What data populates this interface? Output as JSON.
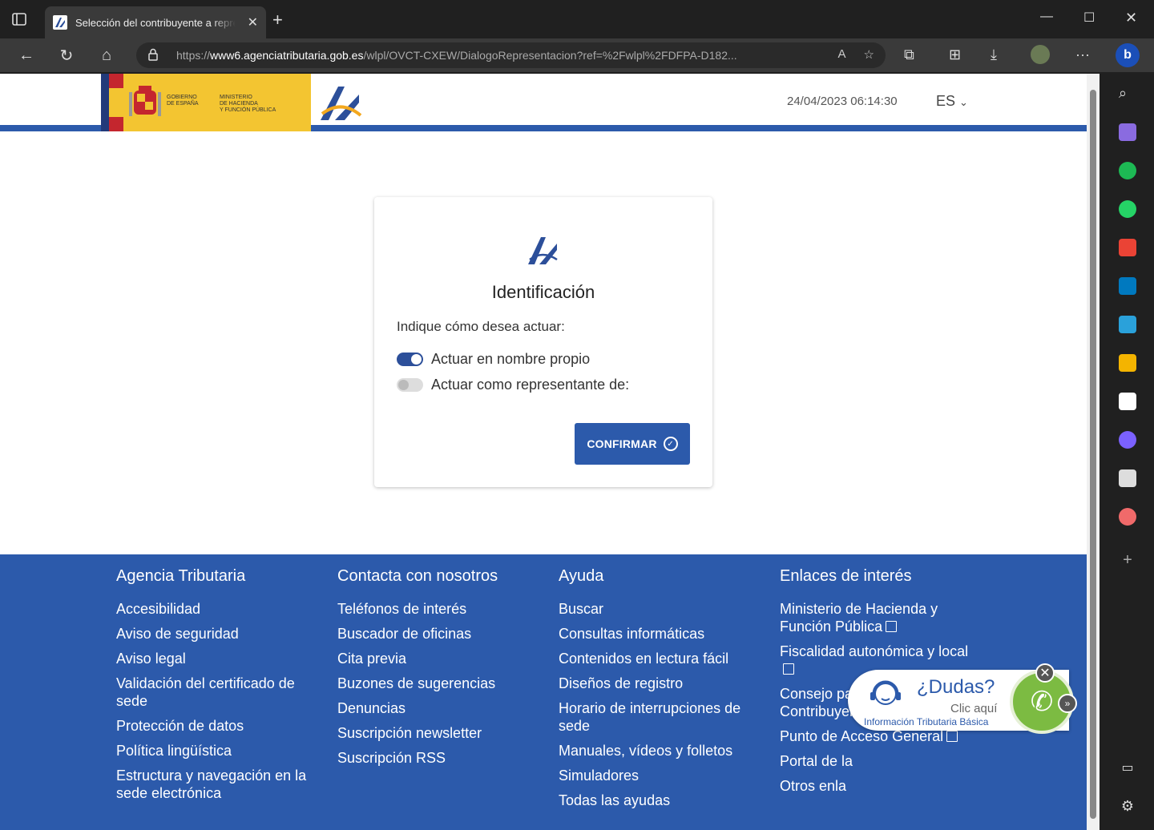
{
  "browser": {
    "tab_title": "Selección del contribuyente a representar",
    "url_prefix": "https://",
    "url_host": "www6.agenciatributaria.gob.es",
    "url_path": "/wlpl/OVCT-CXEW/DialogoRepresentacion?ref=%2Fwlpl%2FDFPA-D182..."
  },
  "header": {
    "gov_line1": "GOBIERNO",
    "gov_line2": "DE ESPAÑA",
    "min_line1": "MINISTERIO",
    "min_line2": "DE HACIENDA",
    "min_line3": "Y FUNCIÓN PÚBLICA",
    "datetime": "24/04/2023 06:14:30",
    "language": "ES"
  },
  "dialog": {
    "title": "Identificación",
    "prompt": "Indique cómo desea actuar:",
    "option_own": "Actuar en nombre propio",
    "option_own_checked": true,
    "option_rep": "Actuar como representante de:",
    "option_rep_checked": false,
    "confirm_label": "CONFIRMAR"
  },
  "footer": {
    "col1": {
      "title": "Agencia Tributaria",
      "links": [
        "Accesibilidad",
        "Aviso de seguridad",
        "Aviso legal",
        "Validación del certificado de sede",
        "Protección de datos",
        "Política lingüística",
        "Estructura y navegación en la sede electrónica"
      ]
    },
    "col2": {
      "title": "Contacta con nosotros",
      "links": [
        "Teléfonos de interés",
        "Buscador de oficinas",
        "Cita previa",
        "Buzones de sugerencias",
        "Denuncias",
        "Suscripción newsletter",
        "Suscripción RSS"
      ]
    },
    "col3": {
      "title": "Ayuda",
      "links": [
        "Buscar",
        "Consultas informáticas",
        "Contenidos en lectura fácil",
        "Diseños de registro",
        "Horario de interrupciones de sede",
        "Manuales, vídeos y folletos",
        "Simuladores",
        "Todas las ayudas"
      ]
    },
    "col4": {
      "title": "Enlaces de interés",
      "links": [
        "Ministerio de Hacienda y Función Pública",
        "Fiscalidad autonómica y local",
        "Consejo para la Defensa del Contribuyente",
        "Punto de Acceso General",
        "Portal de la",
        "Otros enla"
      ]
    }
  },
  "chat_widget": {
    "title": "¿Dudas?",
    "cta": "Clic aquí",
    "subtitle": "Información Tributaria Básica"
  }
}
